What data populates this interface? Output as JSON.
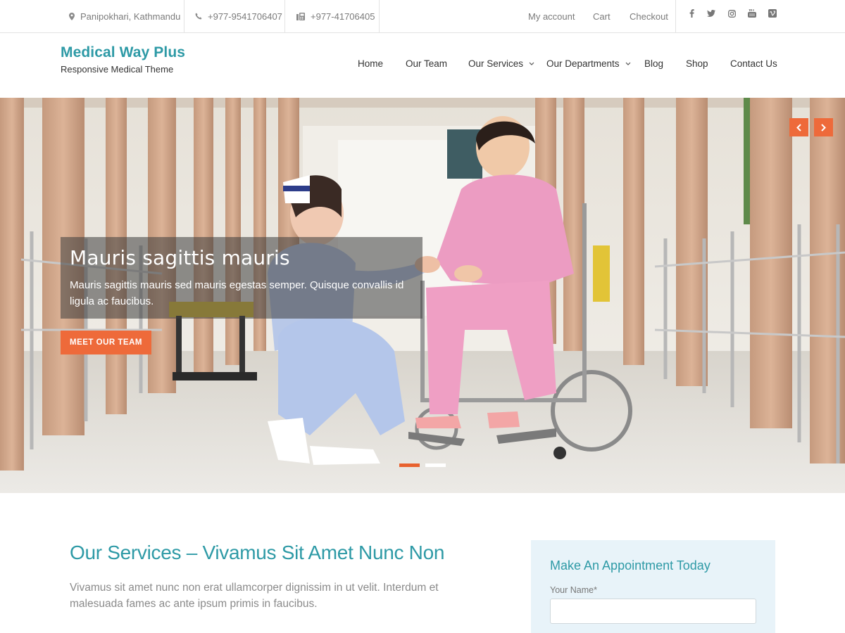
{
  "topbar": {
    "address": "Panipokhari, Kathmandu",
    "phone": "+977-9541706407",
    "fax": "+977-41706405",
    "links": {
      "account": "My account",
      "cart": "Cart",
      "checkout": "Checkout"
    },
    "social_icons": [
      "facebook-icon",
      "twitter-icon",
      "instagram-icon",
      "youtube-icon",
      "vimeo-icon"
    ]
  },
  "header": {
    "site_title": "Medical Way Plus",
    "tagline": "Responsive Medical Theme",
    "nav": {
      "home": "Home",
      "team": "Our Team",
      "services": "Our Services",
      "departments": "Our Departments",
      "blog": "Blog",
      "shop": "Shop",
      "contact": "Contact Us"
    }
  },
  "hero": {
    "title": "Mauris sagittis mauris",
    "text": "Mauris sagittis mauris sed mauris egestas semper. Quisque convallis id ligula ac faucibus.",
    "button": "MEET OUR TEAM",
    "active_slide": 1,
    "slide_count": 2
  },
  "services": {
    "title": "Our Services – Vivamus Sit Amet Nunc Non",
    "text": "Vivamus sit amet nunc non erat ullamcorper dignissim in ut velit. Interdum et malesuada fames ac ante ipsum primis in faucibus."
  },
  "appointment": {
    "title": "Make An Appointment Today",
    "name_label": "Your Name*",
    "name_value": ""
  },
  "colors": {
    "accent": "#2e9aa6",
    "button": "#ee6a3a"
  }
}
